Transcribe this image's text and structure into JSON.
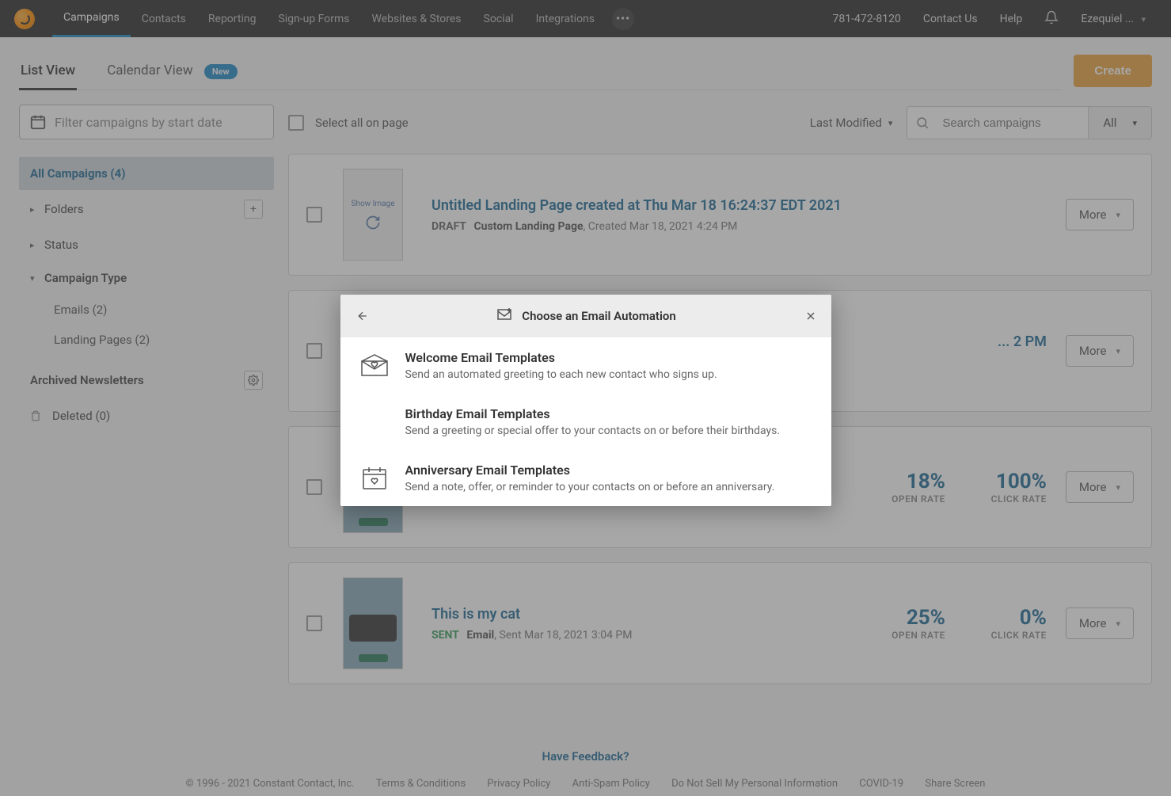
{
  "nav": {
    "items": [
      "Campaigns",
      "Contacts",
      "Reporting",
      "Sign-up Forms",
      "Websites & Stores",
      "Social",
      "Integrations"
    ],
    "phone": "781-472-8120",
    "contact": "Contact Us",
    "help": "Help",
    "user": "Ezequiel ..."
  },
  "tabs": {
    "list": "List View",
    "calendar": "Calendar View",
    "new_badge": "New",
    "create": "Create"
  },
  "sidebar": {
    "date_placeholder": "Filter campaigns by start date",
    "all": "All Campaigns (4)",
    "folders": "Folders",
    "status": "Status",
    "campaign_type": "Campaign Type",
    "emails": "Emails (2)",
    "landing": "Landing Pages (2)",
    "archived": "Archived Newsletters",
    "deleted": "Deleted (0)"
  },
  "toolbar": {
    "select_all": "Select all on page",
    "sort": "Last Modified",
    "search_placeholder": "Search campaigns",
    "filter": "All"
  },
  "campaigns": [
    {
      "title": "Untitled Landing Page created at Thu Mar 18 16:24:37 EDT 2021",
      "status": "DRAFT",
      "type": "Custom Landing Page",
      "meta": ", Created Mar 18, 2021 4:24 PM",
      "thumb_text": "Show Image",
      "more": "More"
    },
    {
      "title": "... 2 PM",
      "more": "More"
    },
    {
      "open": "18%",
      "open_lbl": "OPEN RATE",
      "click": "100%",
      "click_lbl": "CLICK RATE",
      "more": "More"
    },
    {
      "title": "This is my cat",
      "status": "SENT",
      "type": "Email",
      "meta": ", Sent Mar 18, 2021 3:04 PM",
      "open": "25%",
      "open_lbl": "OPEN RATE",
      "click": "0%",
      "click_lbl": "CLICK RATE",
      "more": "More"
    }
  ],
  "modal": {
    "title": "Choose an Email Automation",
    "items": [
      {
        "title": "Welcome Email Templates",
        "desc": "Send an automated greeting to each new contact who signs up."
      },
      {
        "title": "Birthday Email Templates",
        "desc": "Send a greeting or special offer to your contacts on or before their birthdays."
      },
      {
        "title": "Anniversary Email Templates",
        "desc": "Send a note, offer, or reminder to your contacts on or before an anniversary."
      }
    ]
  },
  "footer": {
    "feedback": "Have Feedback?",
    "copyright": "© 1996 - 2021 Constant Contact, Inc.",
    "links": [
      "Terms & Conditions",
      "Privacy Policy",
      "Anti-Spam Policy",
      "Do Not Sell My Personal Information",
      "COVID-19",
      "Share Screen"
    ]
  }
}
